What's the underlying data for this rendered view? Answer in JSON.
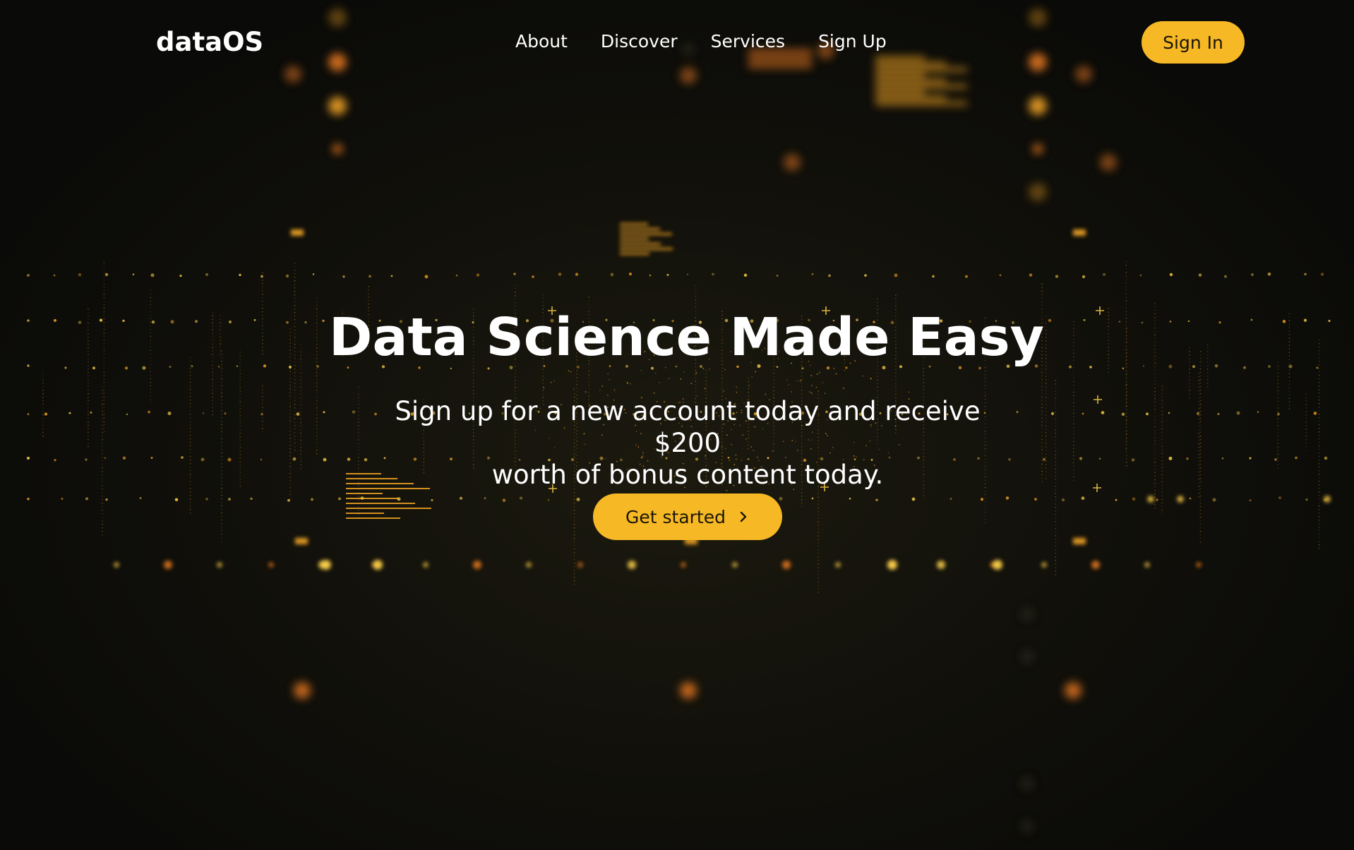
{
  "brand": {
    "logo_text": "dataOS"
  },
  "nav": {
    "items": [
      {
        "label": "About"
      },
      {
        "label": "Discover"
      },
      {
        "label": "Services"
      },
      {
        "label": "Sign Up"
      }
    ],
    "signin_label": "Sign In"
  },
  "hero": {
    "title": "Data Science Made Easy",
    "subtitle_line1": "Sign up for a new account today and receive $200",
    "subtitle_line2": "worth of bonus content today.",
    "cta_label": "Get started",
    "cta_icon": "chevron-right-icon"
  },
  "colors": {
    "accent": "#f7b825",
    "background": "#0b0b09",
    "text": "#ffffff"
  }
}
